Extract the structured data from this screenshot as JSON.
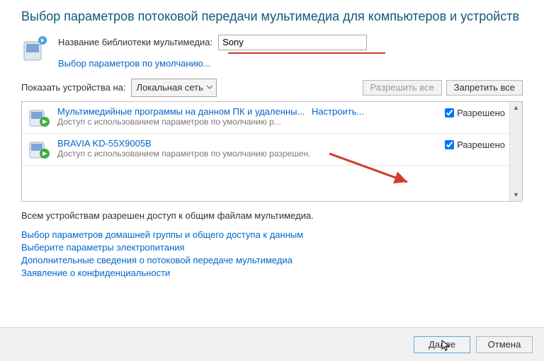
{
  "title": "Выбор параметров потоковой передачи мультимедиа для компьютеров и устройств",
  "library": {
    "label": "Название библиотеки мультимедиа:",
    "value": "Sony",
    "defaults_link": "Выбор параметров по умолчанию..."
  },
  "show_on": {
    "label": "Показать устройства на:",
    "value": "Локальная сеть"
  },
  "buttons": {
    "allow_all": "Разрешить все",
    "block_all": "Запретить все"
  },
  "devices": [
    {
      "name": "Мультимедийные программы на данном ПК и удаленны...",
      "sub": "Доступ с использованием параметров по умолчанию р...",
      "configure": "Настроить...",
      "allowed_label": "Разрешено",
      "allowed": true
    },
    {
      "name": "BRAVIA KD-55X9005B",
      "sub": "Доступ с использованием параметров по умолчанию разрешен.",
      "configure": "",
      "allowed_label": "Разрешено",
      "allowed": true
    }
  ],
  "summary": "Всем устройствам разрешен доступ к общим файлам мультимедиа.",
  "links": [
    "Выбор параметров домашней группы и общего доступа к данным",
    "Выберите параметры электропитания",
    "Дополнительные сведения о потоковой передаче мультимедиа",
    "Заявление о конфиденциальности"
  ],
  "footer": {
    "next": "Далее",
    "cancel": "Отмена"
  }
}
